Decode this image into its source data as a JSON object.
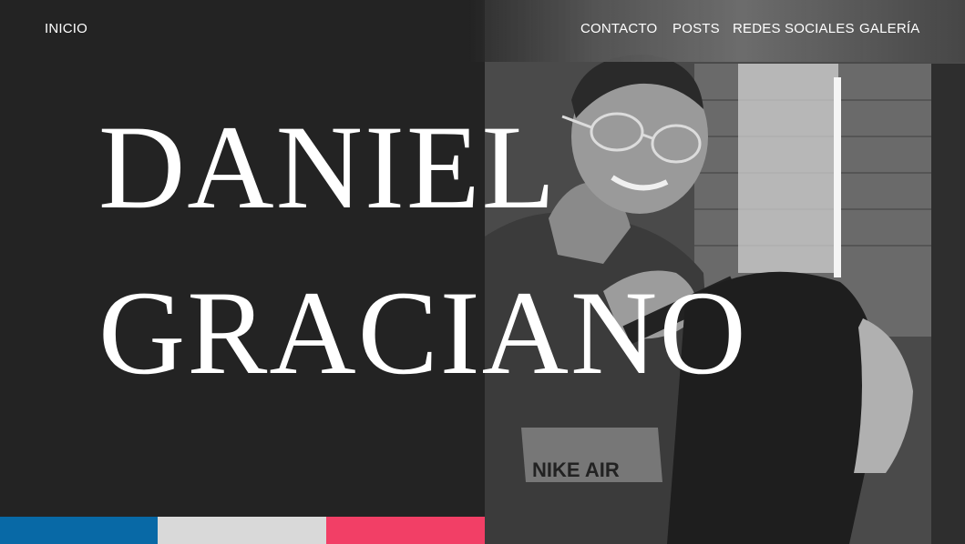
{
  "nav": {
    "home_label": "INICIO",
    "items": [
      {
        "label": "CONTACTO"
      },
      {
        "label": "POSTS"
      },
      {
        "label": "REDES SOCIALES"
      },
      {
        "label": "GALERÍA"
      }
    ]
  },
  "hero": {
    "first_name": "DANIEL",
    "last_name": "GRACIANO"
  },
  "photo": {
    "shirt_text": "NIKE AIR"
  },
  "colors": {
    "background": "#232323",
    "text": "#ffffff",
    "stripe_blue": "#0869a6",
    "stripe_gray": "#d9d9d9",
    "stripe_pink": "#f23f66"
  }
}
